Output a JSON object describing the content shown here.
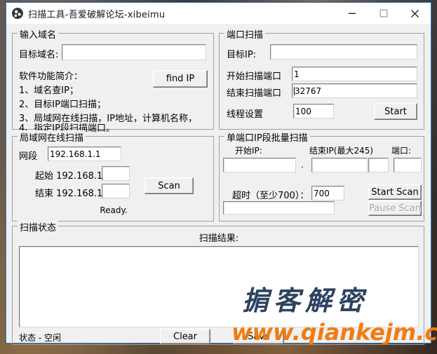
{
  "window": {
    "title": "扫描工具-吾爱破解论坛-xibeimu",
    "icon": "globe-icon",
    "controls": {
      "minimize": "minimize-icon",
      "maximize": "maximize-icon",
      "close": "close-icon"
    }
  },
  "domain_group": {
    "legend": "输入域名",
    "target_domain_label": "目标域名:",
    "target_domain_value": "",
    "find_ip_label": "find IP",
    "intro_lines": [
      "软件功能简介：",
      "1、域名查IP；",
      "2、目标IP端口扫描；",
      "3、局域网在线扫描，IP地址，计算机名称，",
      "4、指定IP段扫描端口。"
    ]
  },
  "port_scan_group": {
    "legend": "端口扫描",
    "target_ip_label": "目标IP:",
    "target_ip_value": "",
    "start_port_label": "开始扫描端口",
    "start_port_value": "1",
    "end_port_label": "结束扫描端口",
    "end_port_value": "32767",
    "thread_label": "线程设置",
    "thread_value": "100",
    "start_button": "Start"
  },
  "lan_scan_group": {
    "legend": "局域网在线扫描",
    "segment_label": "网段",
    "segment_value": "192.168.1.1",
    "start_label": "起始 192.168.1.",
    "start_value": "",
    "end_label": "结束 192.168.1.",
    "end_value": "",
    "scan_button": "Scan",
    "status": "Ready."
  },
  "batch_scan_group": {
    "legend": "单端口IP段批量扫描",
    "start_ip_label": "开始IP:",
    "start_ip_value": "",
    "dot_separator": ".",
    "end_ip_label": "结束IP(最大245)",
    "end_ip_value": "",
    "end_ip_suffix_value": "",
    "port_label": "端口:",
    "port_value": "",
    "timeout_label": "超时（至少700）：",
    "timeout_value": "700",
    "progress_value": "",
    "start_scan_button": "Start Scan",
    "pause_scan_button": "Pause Scan",
    "pause_scan_disabled": true
  },
  "status_group": {
    "legend": "扫描状态",
    "results_label": "扫描结果:",
    "results_value": "",
    "bottom_field_value": "",
    "status_text": "状态 - 空闲",
    "clear_button": "Clear",
    "save_button": "Save"
  },
  "watermark": {
    "brand": "掮客解密",
    "url": "www.qiankejm.cn",
    "brand_color": "#2c4260",
    "url_color": "#f07c12"
  }
}
